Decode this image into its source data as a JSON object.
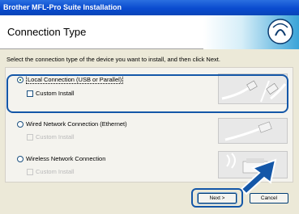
{
  "window": {
    "title": "Brother MFL-Pro Suite Installation"
  },
  "header": {
    "page_title": "Connection Type"
  },
  "instruction": "Select the connection type of the device you want to install, and then click Next.",
  "options": [
    {
      "label": "Local Connection (USB or Parallel)",
      "selected": true,
      "custom_install_label": "Custom Install",
      "custom_install_enabled": true
    },
    {
      "label": "Wired Network Connection (Ethernet)",
      "selected": false,
      "custom_install_label": "Custom Install",
      "custom_install_enabled": false
    },
    {
      "label": "Wireless Network Connection",
      "selected": false,
      "custom_install_label": "Custom Install",
      "custom_install_enabled": false
    }
  ],
  "buttons": {
    "next": "Next >",
    "cancel": "Cancel"
  },
  "icons": [
    "brother-wave-logo-icon",
    "usb-cable-icon",
    "ethernet-cable-icon",
    "wireless-printer-icon",
    "pointer-arrow-icon"
  ],
  "colors": {
    "titlebar": "#0a4bcf",
    "highlight": "#1457a8",
    "accent": "#3aa3d8"
  }
}
